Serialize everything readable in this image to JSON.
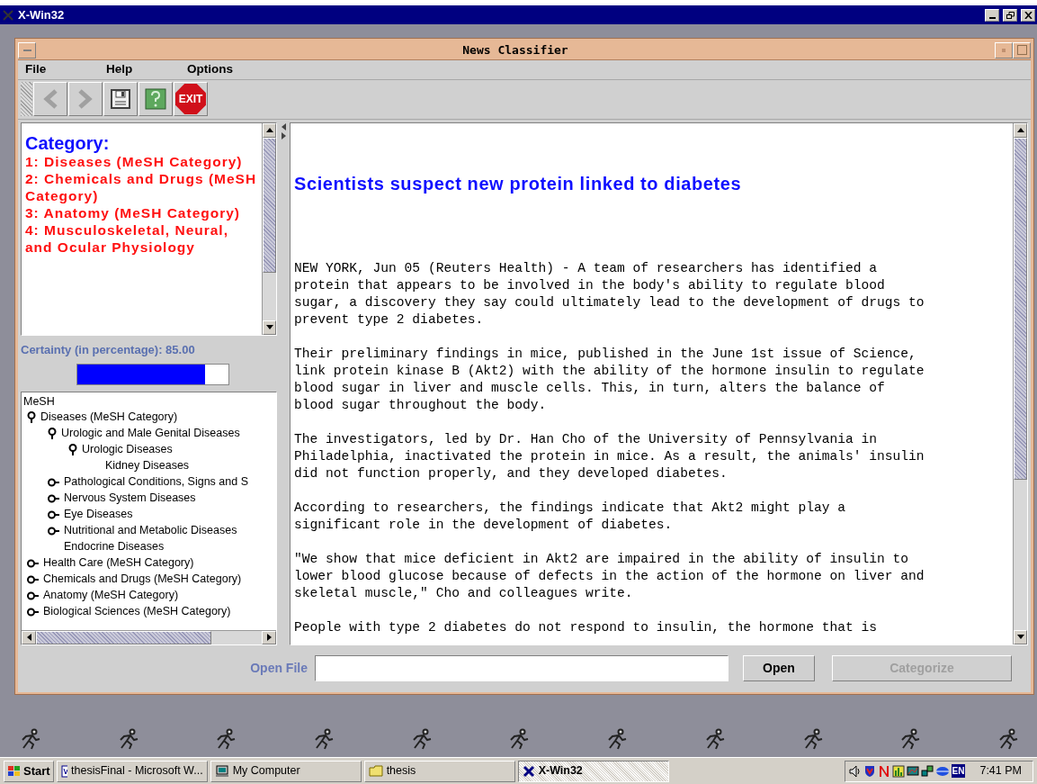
{
  "outer_window": {
    "title": "X-Win32"
  },
  "app_window": {
    "title": "News Classifier"
  },
  "menu": [
    "File",
    "Help",
    "Options"
  ],
  "toolbar": [
    {
      "kind": "back",
      "disabled": true
    },
    {
      "kind": "forward",
      "disabled": true
    },
    {
      "kind": "save"
    },
    {
      "kind": "help"
    },
    {
      "kind": "exit",
      "label": "EXIT"
    }
  ],
  "category": {
    "heading": "Category:",
    "items": [
      "1: Diseases (MeSH Category)",
      "2: Chemicals and Drugs (MeSH Category)",
      "3: Anatomy (MeSH Category)",
      "4: Musculoskeletal, Neural, and Ocular Physiology"
    ]
  },
  "certainty": {
    "label": "Certainty (in percentage): 85.00",
    "level": 0.85
  },
  "tree": {
    "root": "MeSH",
    "children": [
      {
        "label": "Diseases (MeSH Category)",
        "kind": "branch",
        "expanded": true,
        "children": [
          {
            "label": "Urologic and Male Genital Diseases",
            "kind": "branch",
            "expanded": true,
            "children": [
              {
                "label": "Urologic Diseases",
                "kind": "branch",
                "expanded": true,
                "children": [
                  {
                    "label": "Kidney Diseases",
                    "kind": "leaf"
                  }
                ]
              }
            ]
          },
          {
            "label": "Pathological Conditions, Signs and S",
            "kind": "branch",
            "expanded": false
          },
          {
            "label": "Nervous System Diseases",
            "kind": "branch",
            "expanded": false
          },
          {
            "label": "Eye Diseases",
            "kind": "branch",
            "expanded": false
          },
          {
            "label": "Nutritional and Metabolic Diseases",
            "kind": "branch",
            "expanded": false
          },
          {
            "label": "Endocrine Diseases",
            "kind": "leaf"
          }
        ]
      },
      {
        "label": "Health Care (MeSH Category)",
        "kind": "branch",
        "expanded": false
      },
      {
        "label": "Chemicals and Drugs (MeSH Category)",
        "kind": "branch",
        "expanded": false
      },
      {
        "label": "Anatomy (MeSH Category)",
        "kind": "branch",
        "expanded": false
      },
      {
        "label": "Biological Sciences (MeSH Category)",
        "kind": "branch",
        "expanded": false
      }
    ]
  },
  "article": {
    "headline": "Scientists suspect new protein linked to diabetes",
    "paragraphs": [
      [
        "NEW YORK, Jun 05 (Reuters Health) - A team of researchers has identified a",
        "protein that appears to be involved in the body's ability to regulate blood",
        "sugar, a discovery they say could ultimately lead to the development of drugs to",
        "prevent type 2 diabetes."
      ],
      [
        "Their preliminary findings in mice, published in the June 1st issue of Science,",
        "link protein kinase B (Akt2) with the ability of the hormone insulin to regulate",
        "blood sugar in liver and muscle cells. This, in turn, alters the balance of",
        "blood sugar throughout the body."
      ],
      [
        "The investigators, led by Dr. Han Cho of the University of Pennsylvania in",
        "Philadelphia, inactivated the protein in mice. As a result, the animals' insulin",
        "did not function properly, and they developed diabetes."
      ],
      [
        "According to researchers, the findings indicate that Akt2 might play a",
        "significant role in the development of diabetes."
      ],
      [
        "\"We show that mice deficient in Akt2 are impaired in the ability of insulin to",
        "lower blood glucose because of defects in the action of the hormone on liver and",
        "skeletal muscle,\" Cho and colleagues write."
      ],
      [
        "People with type 2 diabetes do not respond to insulin, the hormone that is"
      ]
    ]
  },
  "file_bar": {
    "label": "Open File",
    "open": {
      "label": "Open",
      "disabled": false
    },
    "categorize": {
      "label": "Categorize",
      "disabled": true
    }
  },
  "taskbar": {
    "start": "Start",
    "tasks": [
      {
        "label": "thesisFinal - Microsoft W...",
        "kind": "word",
        "selected": false
      },
      {
        "label": "My Computer",
        "kind": "computer",
        "selected": false
      },
      {
        "label": "thesis",
        "kind": "folder",
        "selected": false
      },
      {
        "label": "X-Win32",
        "kind": "xwin",
        "selected": true
      }
    ],
    "clock": "7:41 PM",
    "tray": [
      "EN"
    ]
  }
}
